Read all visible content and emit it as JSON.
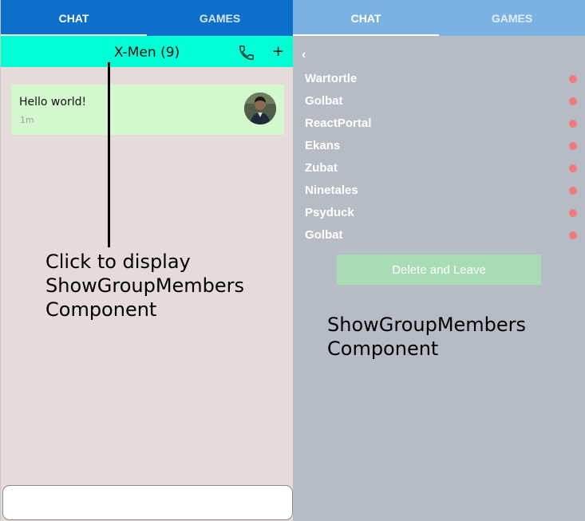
{
  "left_panel": {
    "tabs": [
      {
        "label": "CHAT",
        "active": true
      },
      {
        "label": "GAMES",
        "active": false
      }
    ],
    "group_header": {
      "title": "X-Men (9)",
      "call_icon": "phone-icon",
      "add_icon": "plus-icon",
      "add_label": "+"
    },
    "messages": [
      {
        "text": "Hello world!",
        "time": "1m",
        "avatar": "user-avatar"
      }
    ],
    "annotation": "Click to display\nShowGroupMembers\nComponent",
    "message_input": {
      "value": "",
      "placeholder": ""
    }
  },
  "right_panel": {
    "tabs": [
      {
        "label": "CHAT",
        "active": true
      },
      {
        "label": "GAMES",
        "active": false
      }
    ],
    "back_icon": "chevron-left-icon",
    "back_label": "‹",
    "members": [
      {
        "name": "Wartortle",
        "status": "offline"
      },
      {
        "name": "Golbat",
        "status": "offline"
      },
      {
        "name": "ReactPortal",
        "status": "offline"
      },
      {
        "name": "Ekans",
        "status": "offline"
      },
      {
        "name": "Zubat",
        "status": "offline"
      },
      {
        "name": "Ninetales",
        "status": "offline"
      },
      {
        "name": "Psyduck",
        "status": "offline"
      },
      {
        "name": "Golbat",
        "status": "offline"
      }
    ],
    "delete_button_label": "Delete and Leave",
    "annotation": "ShowGroupMembers\nComponent"
  },
  "colors": {
    "left_tab_bar": "#0b6fcb",
    "right_tab_bar": "#7ab3e2",
    "group_header": "#00ffd5",
    "message_bubble": "#d3f8cd",
    "status_dot": "#ef7b7f",
    "delete_button": "#a8dcb5",
    "left_background": "#e5dcda",
    "right_background": "#b6bcc3"
  }
}
